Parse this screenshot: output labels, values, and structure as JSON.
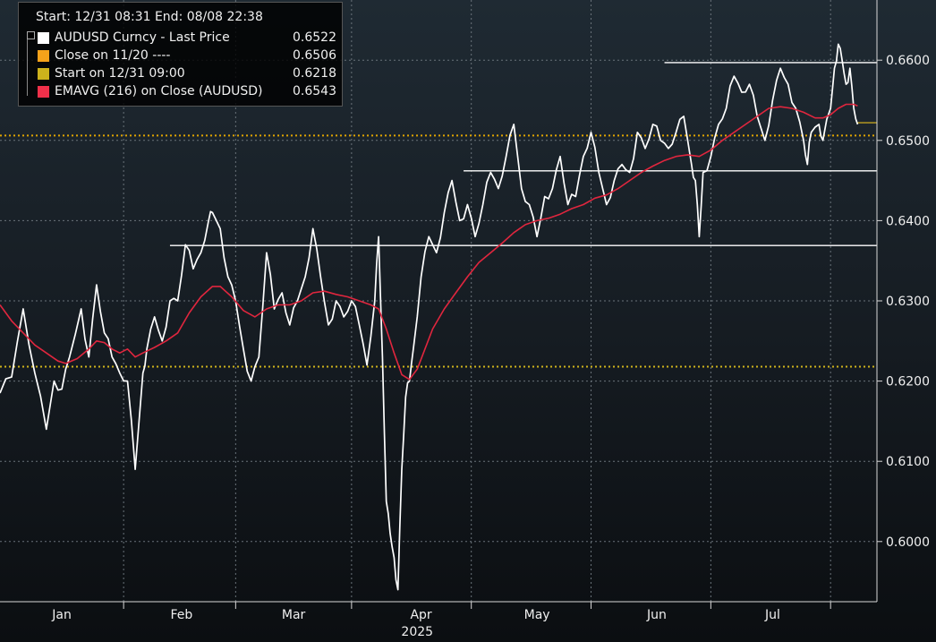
{
  "legend": {
    "range_text": "Start: 12/31 08:31 End: 08/08 22:38",
    "items": [
      {
        "label": "AUDUSD Curncy - Last Price",
        "value": "0.6522",
        "color": "#ffffff"
      },
      {
        "label": "Close on 11/20 ----",
        "value": "0.6506",
        "color": "#f5a21a"
      },
      {
        "label": "Start on 12/31 09:00",
        "value": "0.6218",
        "color": "#cdb21c"
      },
      {
        "label": "EMAVG (216)  on Close (AUDUSD)",
        "value": "0.6543",
        "color": "#f0304a"
      }
    ]
  },
  "chart_data": {
    "type": "line",
    "ylim": [
      0.5925,
      0.6675
    ],
    "xlim": [
      0,
      227
    ],
    "y_ticks": [
      {
        "value": 0.6,
        "label": "0.6000"
      },
      {
        "value": 0.61,
        "label": "0.6100"
      },
      {
        "value": 0.62,
        "label": "0.6200"
      },
      {
        "value": 0.63,
        "label": "0.6300"
      },
      {
        "value": 0.64,
        "label": "0.6400"
      },
      {
        "value": 0.65,
        "label": "0.6500"
      },
      {
        "value": 0.66,
        "label": "0.6600"
      }
    ],
    "x_month_labels": [
      {
        "label": "Jan",
        "x": 16
      },
      {
        "label": "Feb",
        "x": 47
      },
      {
        "label": "Mar",
        "x": 76
      },
      {
        "label": "Apr",
        "x": 109
      },
      {
        "label": "May",
        "x": 139
      },
      {
        "label": "Jun",
        "x": 170
      },
      {
        "label": "Jul",
        "x": 200
      }
    ],
    "x_month_boundaries": [
      32,
      61,
      91,
      122,
      153,
      184,
      215
    ],
    "x_year_label": "2025",
    "x_year_label_x": 108,
    "grid": true,
    "series": [
      {
        "name": "AUDUSD Curncy - Last Price",
        "color": "#ffffff",
        "points": [
          [
            0,
            0.6185
          ],
          [
            3,
            0.6205
          ],
          [
            6,
            0.629
          ],
          [
            9,
            0.621
          ],
          [
            12,
            0.614
          ],
          [
            14,
            0.62
          ],
          [
            16,
            0.619
          ],
          [
            18,
            0.623
          ],
          [
            21,
            0.629
          ],
          [
            23,
            0.623
          ],
          [
            25,
            0.632
          ],
          [
            27,
            0.626
          ],
          [
            29,
            0.623
          ],
          [
            31,
            0.621
          ],
          [
            33,
            0.62
          ],
          [
            35,
            0.609
          ],
          [
            37,
            0.621
          ],
          [
            38,
            0.624
          ],
          [
            40,
            0.628
          ],
          [
            42,
            0.625
          ],
          [
            44,
            0.63
          ],
          [
            46,
            0.63
          ],
          [
            48,
            0.637
          ],
          [
            50,
            0.634
          ],
          [
            52,
            0.636
          ],
          [
            54,
            0.64
          ],
          [
            55,
            0.641
          ],
          [
            57,
            0.639
          ],
          [
            59,
            0.633
          ],
          [
            61,
            0.63
          ],
          [
            63,
            0.624
          ],
          [
            65,
            0.62
          ],
          [
            67,
            0.623
          ],
          [
            69,
            0.636
          ],
          [
            71,
            0.629
          ],
          [
            73,
            0.631
          ],
          [
            75,
            0.627
          ],
          [
            77,
            0.63
          ],
          [
            79,
            0.633
          ],
          [
            81,
            0.639
          ],
          [
            83,
            0.633
          ],
          [
            85,
            0.627
          ],
          [
            87,
            0.63
          ],
          [
            89,
            0.628
          ],
          [
            91,
            0.63
          ],
          [
            93,
            0.627
          ],
          [
            95,
            0.622
          ],
          [
            97,
            0.63
          ],
          [
            98,
            0.638
          ],
          [
            99,
            0.623
          ],
          [
            100,
            0.605
          ],
          [
            101,
            0.601
          ],
          [
            102,
            0.598
          ],
          [
            103,
            0.594
          ],
          [
            104,
            0.609
          ],
          [
            105,
            0.618
          ],
          [
            106,
            0.62
          ],
          [
            107,
            0.624
          ],
          [
            109,
            0.633
          ],
          [
            111,
            0.638
          ],
          [
            113,
            0.636
          ],
          [
            115,
            0.641
          ],
          [
            117,
            0.645
          ],
          [
            119,
            0.64
          ],
          [
            121,
            0.642
          ],
          [
            123,
            0.638
          ],
          [
            125,
            0.642
          ],
          [
            127,
            0.646
          ],
          [
            129,
            0.644
          ],
          [
            131,
            0.648
          ],
          [
            133,
            0.652
          ],
          [
            135,
            0.644
          ],
          [
            137,
            0.642
          ],
          [
            139,
            0.638
          ],
          [
            141,
            0.643
          ],
          [
            143,
            0.644
          ],
          [
            145,
            0.648
          ],
          [
            147,
            0.642
          ],
          [
            149,
            0.643
          ],
          [
            151,
            0.648
          ],
          [
            153,
            0.651
          ],
          [
            155,
            0.646
          ],
          [
            157,
            0.642
          ],
          [
            159,
            0.645
          ],
          [
            161,
            0.647
          ],
          [
            163,
            0.646
          ],
          [
            165,
            0.651
          ],
          [
            167,
            0.649
          ],
          [
            169,
            0.652
          ],
          [
            171,
            0.65
          ],
          [
            173,
            0.649
          ],
          [
            175,
            0.651
          ],
          [
            177,
            0.653
          ],
          [
            179,
            0.647
          ],
          [
            180,
            0.645
          ],
          [
            181,
            0.638
          ],
          [
            182,
            0.646
          ],
          [
            184,
            0.648
          ],
          [
            186,
            0.652
          ],
          [
            188,
            0.654
          ],
          [
            190,
            0.658
          ],
          [
            192,
            0.656
          ],
          [
            194,
            0.657
          ],
          [
            196,
            0.653
          ],
          [
            198,
            0.65
          ],
          [
            200,
            0.655
          ],
          [
            202,
            0.659
          ],
          [
            204,
            0.657
          ],
          [
            206,
            0.654
          ],
          [
            208,
            0.65
          ],
          [
            209,
            0.647
          ],
          [
            210,
            0.651
          ],
          [
            212,
            0.652
          ],
          [
            213,
            0.65
          ],
          [
            215,
            0.654
          ],
          [
            216,
            0.659
          ],
          [
            217,
            0.662
          ],
          [
            218,
            0.66
          ],
          [
            219,
            0.657
          ],
          [
            220,
            0.659
          ],
          [
            221,
            0.654
          ],
          [
            222,
            0.652
          ]
        ]
      },
      {
        "name": "EMAVG (216)  on Close (AUDUSD)",
        "color": "#e0263e",
        "points": [
          [
            0,
            0.6295
          ],
          [
            3,
            0.6275
          ],
          [
            6,
            0.626
          ],
          [
            9,
            0.6245
          ],
          [
            12,
            0.6235
          ],
          [
            15,
            0.6225
          ],
          [
            17,
            0.6222
          ],
          [
            20,
            0.6228
          ],
          [
            23,
            0.624
          ],
          [
            25,
            0.625
          ],
          [
            27,
            0.6248
          ],
          [
            29,
            0.624
          ],
          [
            31,
            0.6235
          ],
          [
            33,
            0.624
          ],
          [
            35,
            0.623
          ],
          [
            37,
            0.6235
          ],
          [
            40,
            0.6242
          ],
          [
            43,
            0.625
          ],
          [
            46,
            0.626
          ],
          [
            49,
            0.6285
          ],
          [
            52,
            0.6305
          ],
          [
            55,
            0.6318
          ],
          [
            57,
            0.6318
          ],
          [
            60,
            0.6305
          ],
          [
            63,
            0.6288
          ],
          [
            66,
            0.628
          ],
          [
            69,
            0.629
          ],
          [
            72,
            0.6295
          ],
          [
            75,
            0.6295
          ],
          [
            78,
            0.63
          ],
          [
            81,
            0.631
          ],
          [
            84,
            0.6312
          ],
          [
            87,
            0.6308
          ],
          [
            90,
            0.6305
          ],
          [
            93,
            0.63
          ],
          [
            96,
            0.6295
          ],
          [
            98,
            0.629
          ],
          [
            100,
            0.6265
          ],
          [
            102,
            0.6235
          ],
          [
            104,
            0.6208
          ],
          [
            106,
            0.6202
          ],
          [
            108,
            0.6215
          ],
          [
            110,
            0.624
          ],
          [
            112,
            0.6265
          ],
          [
            115,
            0.629
          ],
          [
            118,
            0.631
          ],
          [
            121,
            0.633
          ],
          [
            124,
            0.6348
          ],
          [
            127,
            0.636
          ],
          [
            130,
            0.6372
          ],
          [
            133,
            0.6385
          ],
          [
            136,
            0.6395
          ],
          [
            139,
            0.64
          ],
          [
            142,
            0.6403
          ],
          [
            145,
            0.6408
          ],
          [
            148,
            0.6415
          ],
          [
            151,
            0.642
          ],
          [
            154,
            0.6428
          ],
          [
            157,
            0.6432
          ],
          [
            160,
            0.644
          ],
          [
            163,
            0.645
          ],
          [
            166,
            0.646
          ],
          [
            169,
            0.6468
          ],
          [
            172,
            0.6475
          ],
          [
            175,
            0.648
          ],
          [
            178,
            0.6482
          ],
          [
            181,
            0.648
          ],
          [
            184,
            0.6488
          ],
          [
            187,
            0.65
          ],
          [
            190,
            0.651
          ],
          [
            193,
            0.652
          ],
          [
            196,
            0.653
          ],
          [
            199,
            0.654
          ],
          [
            202,
            0.6542
          ],
          [
            205,
            0.654
          ],
          [
            208,
            0.6535
          ],
          [
            211,
            0.6528
          ],
          [
            213,
            0.6528
          ],
          [
            215,
            0.6532
          ],
          [
            217,
            0.654
          ],
          [
            219,
            0.6545
          ],
          [
            221,
            0.6545
          ],
          [
            222,
            0.6543
          ]
        ]
      }
    ],
    "reference_lines": [
      {
        "name": "Close on 11/20",
        "value": 0.6506,
        "color": "#e0a400",
        "style": "dotted",
        "x_from": 0,
        "x_to": 227
      },
      {
        "name": "Start on 12/31 09:00",
        "value": 0.6218,
        "color": "#cdb21c",
        "style": "dotted",
        "x_from": 0,
        "x_to": 227
      },
      {
        "name": "last-price-marker",
        "value": 0.6522,
        "color": "#c0a020",
        "style": "solid",
        "x_from": 222,
        "x_to": 227
      },
      {
        "name": "resistance-1",
        "value": 0.6597,
        "color": "#ffffff",
        "style": "solid",
        "x_from": 172,
        "x_to": 227
      },
      {
        "name": "support-1",
        "value": 0.6462,
        "color": "#ffffff",
        "style": "solid",
        "x_from": 120,
        "x_to": 227
      },
      {
        "name": "support-2",
        "value": 0.6369,
        "color": "#ffffff",
        "style": "solid",
        "x_from": 44,
        "x_to": 227
      }
    ]
  }
}
